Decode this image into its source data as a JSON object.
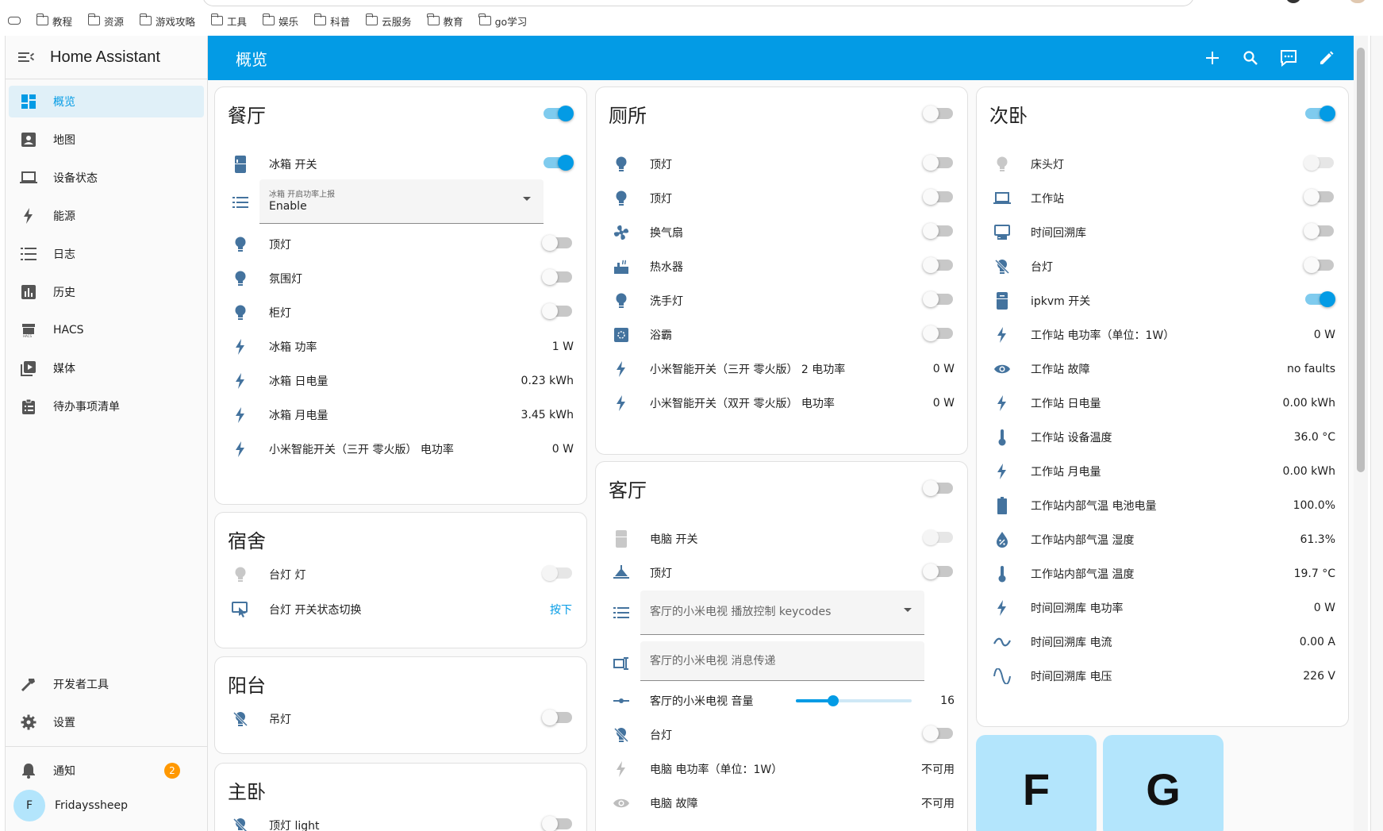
{
  "browser": {
    "bookmarks": [
      "教程",
      "资源",
      "游戏攻略",
      "工具",
      "娱乐",
      "科普",
      "云服务",
      "教育",
      "go学习"
    ]
  },
  "sidebar": {
    "title": "Home Assistant",
    "items": [
      {
        "label": "概览",
        "icon": "dashboard-icon",
        "active": true
      },
      {
        "label": "地图",
        "icon": "map-account-icon"
      },
      {
        "label": "设备状态",
        "icon": "laptop-icon"
      },
      {
        "label": "能源",
        "icon": "lightning-icon"
      },
      {
        "label": "日志",
        "icon": "list-icon"
      },
      {
        "label": "历史",
        "icon": "chart-box-icon"
      },
      {
        "label": "HACS",
        "icon": "hacs-icon"
      },
      {
        "label": "媒体",
        "icon": "play-box-icon"
      },
      {
        "label": "待办事项清单",
        "icon": "clipboard-list-icon"
      }
    ],
    "dev_tools": "开发者工具",
    "settings": "设置",
    "notifications": "通知",
    "notifications_count": "2",
    "user_initial": "F",
    "user_name": "Fridayssheep"
  },
  "header": {
    "title": "概览"
  },
  "cards": {
    "canting": {
      "title": "餐厅",
      "toggle": "on",
      "rows": [
        {
          "label": "冰箱 开关",
          "type": "toggle",
          "state": "on",
          "icon": "fridge-icon"
        },
        {
          "label": "顶灯",
          "type": "toggle",
          "state": "off",
          "icon": "bulb-icon"
        },
        {
          "label": "氛围灯",
          "type": "toggle",
          "state": "off",
          "icon": "bulb-icon"
        },
        {
          "label": "柜灯",
          "type": "toggle",
          "state": "off",
          "icon": "bulb-icon"
        },
        {
          "label": "冰箱 功率",
          "value": "1 W",
          "icon": "flash-icon"
        },
        {
          "label": "冰箱 日电量",
          "value": "0.23 kWh",
          "icon": "flash-icon"
        },
        {
          "label": "冰箱 月电量",
          "value": "3.45 kWh",
          "icon": "flash-icon"
        },
        {
          "label": "小米智能开关（三开 零火版） 电功率",
          "value": "0 W",
          "icon": "flash-icon"
        }
      ],
      "select": {
        "label": "冰箱 开启功率上报",
        "value": "Enable"
      }
    },
    "sushe": {
      "title": "宿舍",
      "rows": [
        {
          "label": "台灯 灯",
          "type": "toggle",
          "state": "disabled"
        },
        {
          "label": "台灯 开关状态切换",
          "button": "按下"
        }
      ]
    },
    "yangtai": {
      "title": "阳台",
      "rows": [
        {
          "label": "吊灯",
          "type": "toggle",
          "state": "off"
        }
      ]
    },
    "zhuwo": {
      "title": "主卧",
      "rows": [
        {
          "label": "顶灯 light",
          "type": "toggle",
          "state": "off"
        }
      ]
    },
    "cesuo": {
      "title": "厕所",
      "toggle": "off",
      "rows": [
        {
          "label": "顶灯",
          "type": "toggle",
          "state": "off"
        },
        {
          "label": "顶灯",
          "type": "toggle",
          "state": "off"
        },
        {
          "label": "换气扇",
          "type": "toggle",
          "state": "off"
        },
        {
          "label": "热水器",
          "type": "toggle",
          "state": "off"
        },
        {
          "label": "洗手灯",
          "type": "toggle",
          "state": "off"
        },
        {
          "label": "浴霸",
          "type": "toggle",
          "state": "off"
        },
        {
          "label": "小米智能开关（三开 零火版） 2 电功率",
          "value": "0 W"
        },
        {
          "label": "小米智能开关（双开 零火版） 电功率",
          "value": "0 W"
        }
      ]
    },
    "keting": {
      "title": "客厅",
      "toggle": "off",
      "rows": [
        {
          "label": "电脑 开关",
          "type": "toggle",
          "state": "disabled"
        },
        {
          "label": "顶灯",
          "type": "toggle",
          "state": "off"
        },
        {
          "label": "客厅的小米电视 音量",
          "value": "16",
          "slider": 0.32
        },
        {
          "label": "台灯",
          "type": "toggle",
          "state": "off"
        },
        {
          "label": "电脑 电功率（单位：1W）",
          "value": "不可用"
        },
        {
          "label": "电脑 故障",
          "value": "不可用"
        }
      ],
      "select_placeholder": "客厅的小米电视 播放控制 keycodes",
      "text_placeholder": "客厅的小米电视 消息传递"
    },
    "ciwo": {
      "title": "次卧",
      "toggle": "on",
      "rows": [
        {
          "label": "床头灯",
          "type": "toggle",
          "state": "disabled"
        },
        {
          "label": "工作站",
          "type": "toggle",
          "state": "off"
        },
        {
          "label": "时间回溯库",
          "type": "toggle",
          "state": "off"
        },
        {
          "label": "台灯",
          "type": "toggle",
          "state": "off"
        },
        {
          "label": "ipkvm 开关",
          "type": "toggle",
          "state": "on"
        },
        {
          "label": "工作站 电功率（单位：1W）",
          "value": "0 W"
        },
        {
          "label": "工作站 故障",
          "value": "no faults"
        },
        {
          "label": "工作站 日电量",
          "value": "0.00 kWh"
        },
        {
          "label": "工作站 设备温度",
          "value": "36.0 °C"
        },
        {
          "label": "工作站 月电量",
          "value": "0.00 kWh"
        },
        {
          "label": "工作站内部气温 电池电量",
          "value": "100.0%"
        },
        {
          "label": "工作站内部气温 湿度",
          "value": "61.3%"
        },
        {
          "label": "工作站内部气温 温度",
          "value": "19.7 °C"
        },
        {
          "label": "时间回溯库 电功率",
          "value": "0 W"
        },
        {
          "label": "时间回溯库 电流",
          "value": "0.00 A"
        },
        {
          "label": "时间回溯库 电压",
          "value": "226 V"
        }
      ]
    },
    "tiles": [
      "F",
      "G"
    ]
  },
  "colors": {
    "primary": "#039be5",
    "icon": "#44739e",
    "badge": "#ff9800"
  }
}
